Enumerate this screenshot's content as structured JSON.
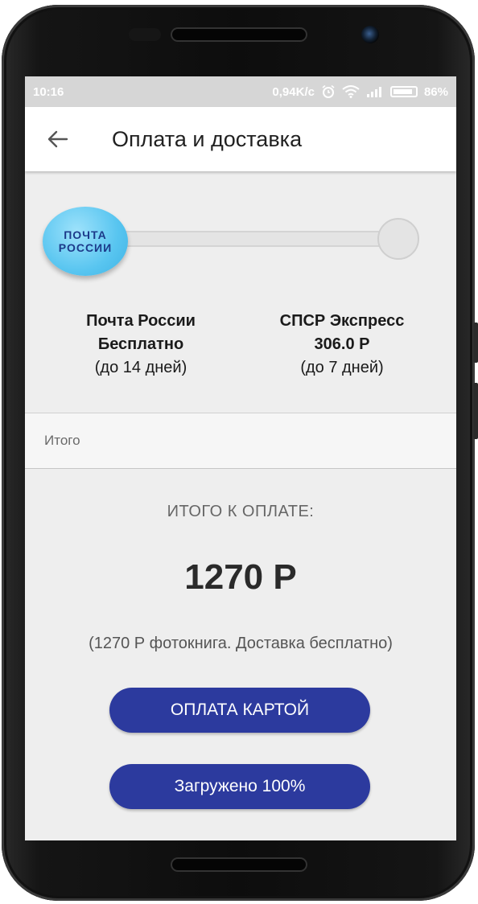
{
  "status_bar": {
    "time": "10:16",
    "network_speed": "0,94K/c",
    "battery": "86%"
  },
  "app_bar": {
    "back_icon": "arrow-left-icon",
    "title": "Оплата и доставка"
  },
  "delivery": {
    "logo_line1": "ПОЧТА",
    "logo_line2": "РОССИИ",
    "selected_index": 0,
    "options": [
      {
        "name": "Почта России",
        "price": "Бесплатно",
        "term": "(до 14 дней)"
      },
      {
        "name": "СПСР Экспресс",
        "price": "306.0 Р",
        "term": "(до 7 дней)"
      }
    ]
  },
  "summary": {
    "row_label": "Итого",
    "total_label": "ИТОГО К ОПЛАТЕ:",
    "total_amount": "1270 Р",
    "total_note": "(1270 Р фотокнига. Доставка бесплатно)"
  },
  "buttons": {
    "pay_label": "ОПЛАТА КАРТОЙ",
    "upload_label": "Загружено 100%"
  },
  "colors": {
    "accent": "#2c3a9e",
    "logo_blue": "#58c5f0"
  }
}
